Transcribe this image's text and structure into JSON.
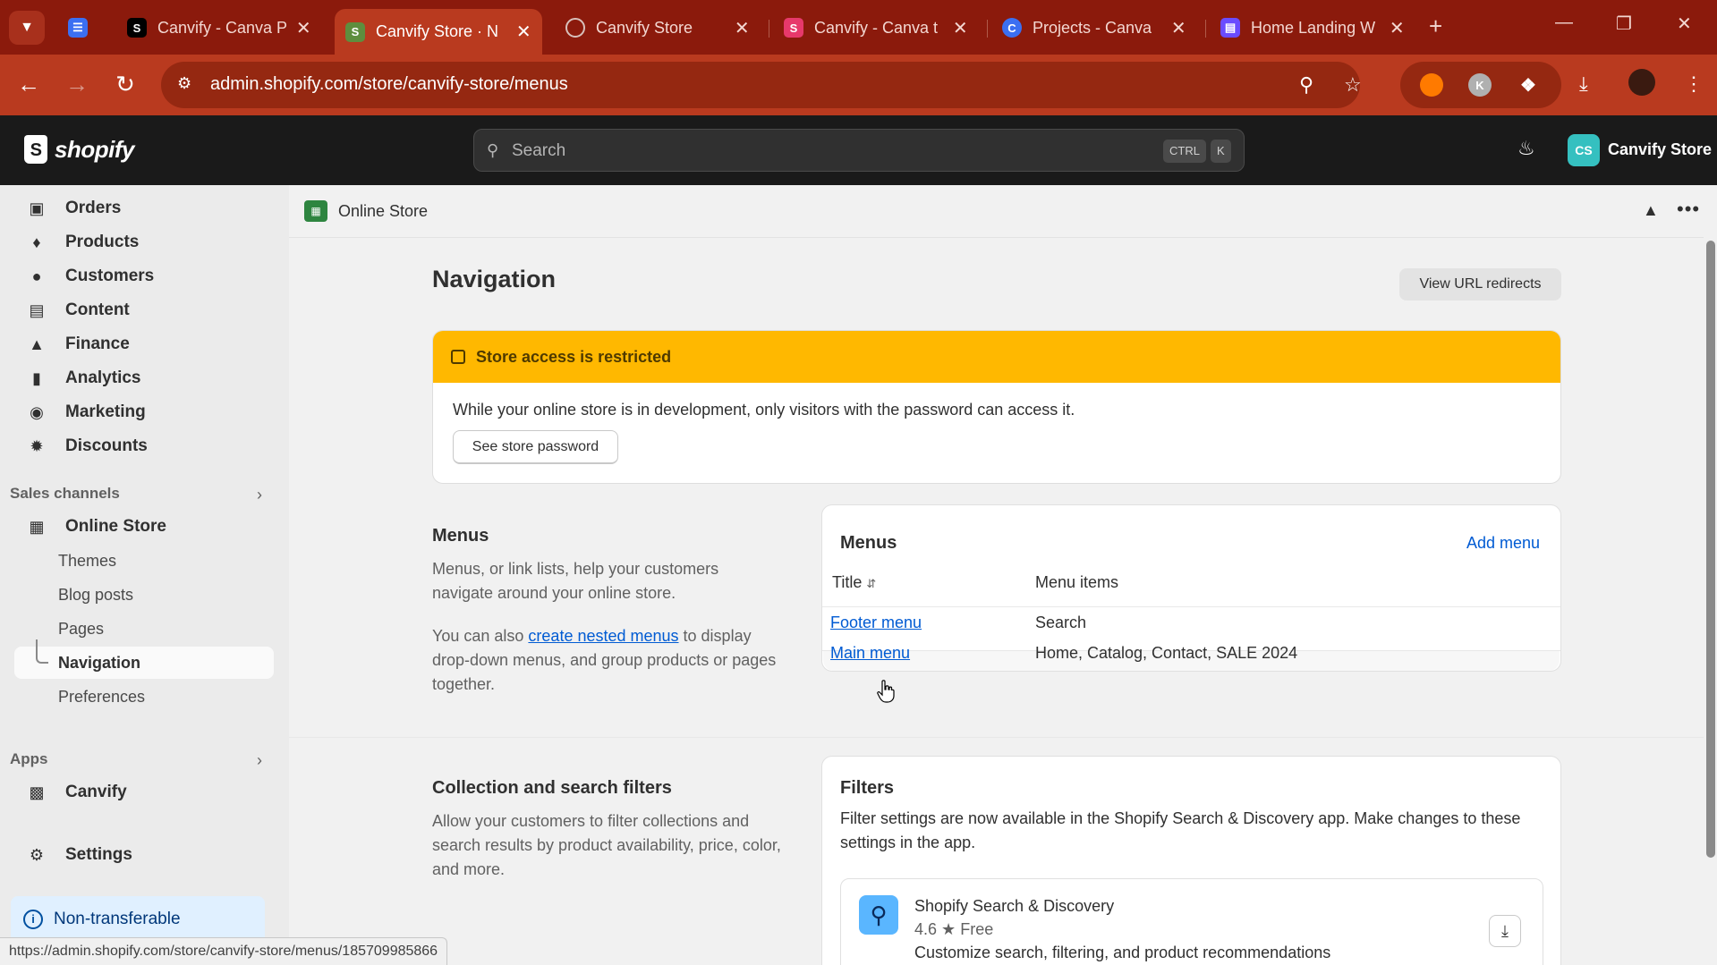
{
  "browser": {
    "tabs": [
      {
        "label": "Canvify - Canva P",
        "icon": "shopify-favicon",
        "color": "#000000"
      },
      {
        "label": "Canvify Store · N",
        "icon": "shopify-favicon",
        "color": "#5e8e3e",
        "active": true
      },
      {
        "label": "Canvify Store",
        "icon": "globe-favicon",
        "color": "#d0d0d0"
      },
      {
        "label": "Canvify - Canva t",
        "icon": "canvify-favicon",
        "color": "#e7396b"
      },
      {
        "label": "Projects - Canva",
        "icon": "canva-favicon",
        "color": "#3b6ff2"
      },
      {
        "label": "Home Landing W",
        "icon": "calendar-favicon",
        "color": "#6a4cff"
      }
    ],
    "url": "admin.shopify.com/store/canvify-store/menus",
    "status_url": "https://admin.shopify.com/store/canvify-store/menus/185709985866"
  },
  "topbar": {
    "logo": "shopify",
    "search_placeholder": "Search",
    "shortcut_ctrl": "CTRL",
    "shortcut_k": "K",
    "store_initials": "CS",
    "store_name": "Canvify Store"
  },
  "sidebar": {
    "items": [
      {
        "label": "Orders",
        "icon": "orders-icon"
      },
      {
        "label": "Products",
        "icon": "tag-icon"
      },
      {
        "label": "Customers",
        "icon": "person-icon"
      },
      {
        "label": "Content",
        "icon": "content-icon"
      },
      {
        "label": "Finance",
        "icon": "bank-icon"
      },
      {
        "label": "Analytics",
        "icon": "bar-chart-icon"
      },
      {
        "label": "Marketing",
        "icon": "target-icon"
      },
      {
        "label": "Discounts",
        "icon": "discount-icon"
      }
    ],
    "sales_channels_label": "Sales channels",
    "online_store": "Online Store",
    "sub_items": [
      "Themes",
      "Blog posts",
      "Pages",
      "Navigation",
      "Preferences"
    ],
    "apps_label": "Apps",
    "canvify": "Canvify",
    "settings": "Settings",
    "non_transferable": "Non-transferable"
  },
  "main": {
    "breadcrumb": "Online Store",
    "title": "Navigation",
    "view_redirects": "View URL redirects",
    "banner": {
      "title": "Store access is restricted",
      "body": "While your online store is in development, only visitors with the password can access it.",
      "button": "See store password"
    },
    "menus_section": {
      "title": "Menus",
      "desc1": "Menus, or link lists, help your customers navigate around your online store.",
      "desc2_before": "You can also ",
      "desc2_link": "create nested menus",
      "desc2_after": " to display drop-down menus, and group products or pages together."
    },
    "menus_card": {
      "title": "Menus",
      "add": "Add menu",
      "col_title": "Title",
      "col_items": "Menu items",
      "rows": [
        {
          "title": "Footer menu",
          "items": "Search"
        },
        {
          "title": "Main menu",
          "items": "Home, Catalog, Contact, SALE 2024"
        }
      ]
    },
    "filters_section": {
      "title": "Collection and search filters",
      "desc": "Allow your customers to filter collections and search results by product availability, price, color, and more."
    },
    "filters_card": {
      "title": "Filters",
      "desc": "Filter settings are now available in the Shopify Search & Discovery app. Make changes to these settings in the app.",
      "app_name": "Shopify Search & Discovery",
      "app_rating": "4.6",
      "app_price": "Free",
      "app_desc": "Customize search, filtering, and product recommendations"
    }
  },
  "colors": {
    "chrome": "#b93a1f",
    "banner": "#ffb800",
    "link": "#005bd3"
  }
}
